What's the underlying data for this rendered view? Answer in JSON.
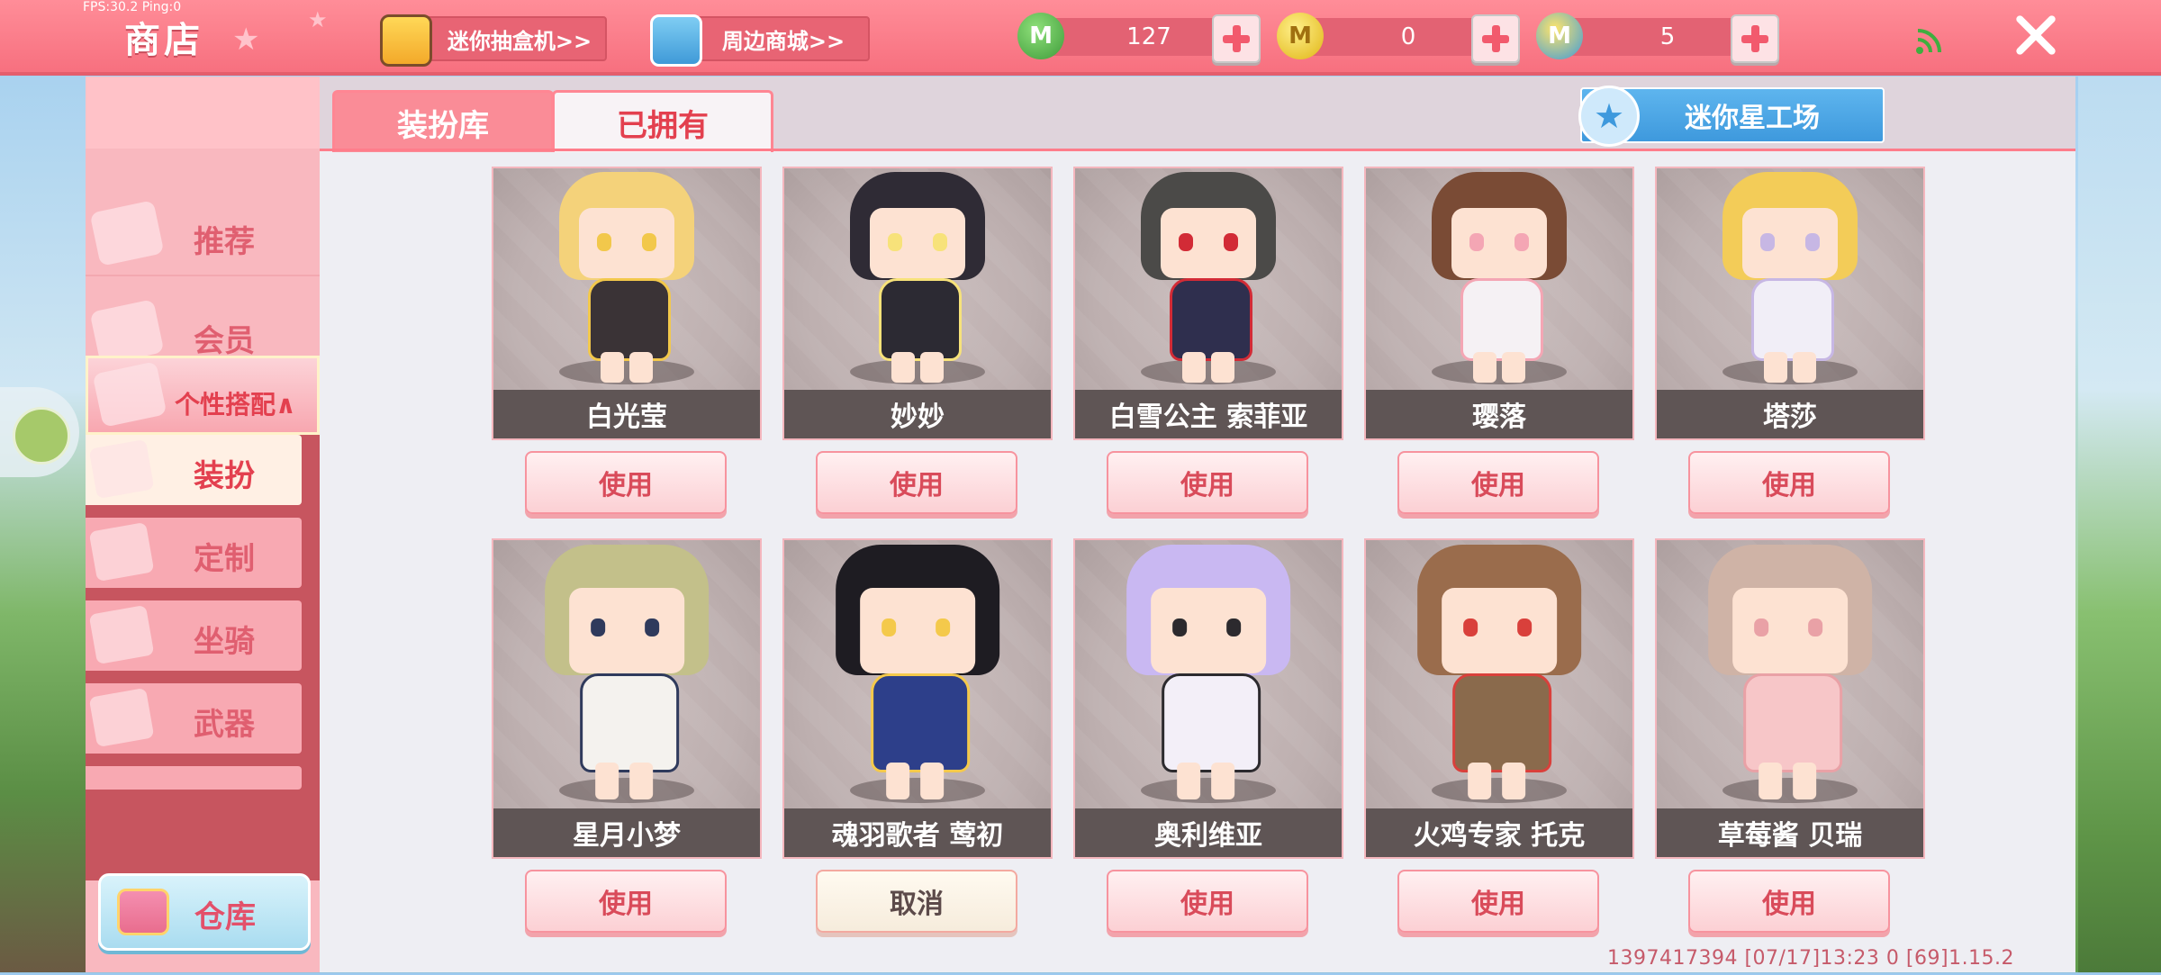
{
  "status": {
    "fps": "FPS:30.2  Ping:0"
  },
  "header": {
    "title": "商店",
    "links": [
      {
        "label": "迷你抽盒机>>"
      },
      {
        "label": "周边商城>>"
      }
    ],
    "currencies": [
      {
        "icon": "green-mini-bean-icon",
        "value": "127",
        "color": "#4aa84a"
      },
      {
        "icon": "gold-coin-icon",
        "value": "0",
        "color": "#e8c31e"
      },
      {
        "icon": "mini-coin-icon",
        "value": "5",
        "color": "#3f9ad8"
      }
    ]
  },
  "sidebar": {
    "items": [
      {
        "label": "推荐",
        "icon": "thumbs-up-icon"
      },
      {
        "label": "会员",
        "icon": "vip-card-icon"
      },
      {
        "label": "个性搭配∧",
        "icon": "crown-icon"
      }
    ],
    "submenu": [
      {
        "label": "装扮",
        "icon": "shirt-icon",
        "active": true
      },
      {
        "label": "定制",
        "icon": "brush-icon"
      },
      {
        "label": "坐骑",
        "icon": "mount-icon"
      },
      {
        "label": "武器",
        "icon": "gun-icon"
      }
    ],
    "warehouse": {
      "label": "仓库"
    }
  },
  "tabs": [
    {
      "label": "装扮库",
      "active": false
    },
    {
      "label": "已拥有",
      "active": true
    }
  ],
  "workshop": {
    "label": "迷你星工场"
  },
  "skins": [
    {
      "name": "白光莹",
      "button": "使用",
      "hair": "#f4d27a",
      "outfit": "#3a3336",
      "accent": "#f2c84b"
    },
    {
      "name": "妙妙",
      "button": "使用",
      "hair": "#2f2b35",
      "outfit": "#2c2a33",
      "accent": "#f7e27a"
    },
    {
      "name": "白雪公主 索菲亚",
      "button": "使用",
      "hair": "#4b4a48",
      "outfit": "#2f2f4e",
      "accent": "#d22b36"
    },
    {
      "name": "璎落",
      "button": "使用",
      "hair": "#7a4b35",
      "outfit": "#f5f1f4",
      "accent": "#f4a6b4"
    },
    {
      "name": "塔莎",
      "button": "使用",
      "hair": "#f3cc58",
      "outfit": "#f1eef7",
      "accent": "#c7b7e4"
    },
    {
      "name": "星月小梦",
      "button": "使用",
      "hair": "#c3c08a",
      "outfit": "#f4f2ee",
      "accent": "#2f3a5c"
    },
    {
      "name": "魂羽歌者 莺初",
      "button": "取消",
      "hair": "#1e1c22",
      "outfit": "#2d3f8a",
      "accent": "#f4c94b"
    },
    {
      "name": "奥利维亚",
      "button": "使用",
      "hair": "#c9b8f2",
      "outfit": "#f3eff8",
      "accent": "#2c2a2e"
    },
    {
      "name": "火鸡专家 托克",
      "button": "使用",
      "hair": "#9a6c4c",
      "outfit": "#8a6a4c",
      "accent": "#d9403b"
    },
    {
      "name": "草莓酱 贝瑞",
      "button": "使用",
      "hair": "#cfb3a6",
      "outfit": "#f7c6c8",
      "accent": "#e9a1a6"
    }
  ],
  "footer": {
    "info": "1397417394   [07/17]13:23 0   [69]1.15.2"
  }
}
